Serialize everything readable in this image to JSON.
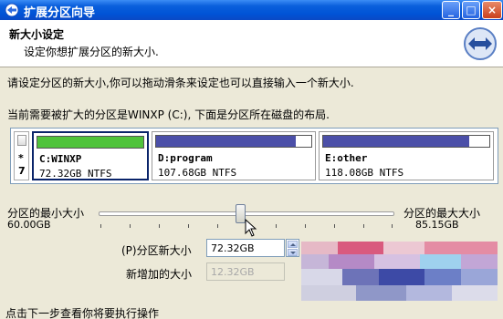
{
  "window": {
    "title": "扩展分区向导",
    "min_label": "_",
    "max_label": "□",
    "close_label": "×"
  },
  "header": {
    "title": "新大小设定",
    "subtitle": "设定你想扩展分区的新大小."
  },
  "instructions": {
    "line1": "请设定分区的新大小,你可以拖动滑条来设定也可以直接输入一个新大小.",
    "line2": "当前需要被扩大的分区是WINXP (C:), 下面是分区所在磁盘的布局."
  },
  "disk_layout": {
    "legend_star": "*",
    "legend_num": "7",
    "partitions": [
      {
        "name": "C:WINXP",
        "size": "72.32GB NTFS",
        "used_fraction": 1.0,
        "bar_color": "#4fc33b",
        "selected": true
      },
      {
        "name": "D:program",
        "size": "107.68GB NTFS",
        "used_fraction": 0.9,
        "bar_color": "#4b4fa8",
        "selected": false
      },
      {
        "name": "E:other",
        "size": "118.08GB NTFS",
        "used_fraction": 0.88,
        "bar_color": "#4b4fa8",
        "selected": false
      }
    ]
  },
  "slider": {
    "min_label": "分区的最小大小",
    "min_value": "60.00GB",
    "max_label": "分区的最大大小",
    "max_value": "85.15GB",
    "position_fraction": 0.48
  },
  "new_size": {
    "label": "(P)分区新大小",
    "value": "72.32GB"
  },
  "added_size": {
    "label": "新增加的大小",
    "value": "12.32GB"
  },
  "footer": {
    "text": "点击下一步查看你将要执行操作"
  },
  "colors": {
    "titlebar": "#0053d6",
    "dialog_bg": "#ece9d8",
    "selected_border": "#0a246a"
  }
}
